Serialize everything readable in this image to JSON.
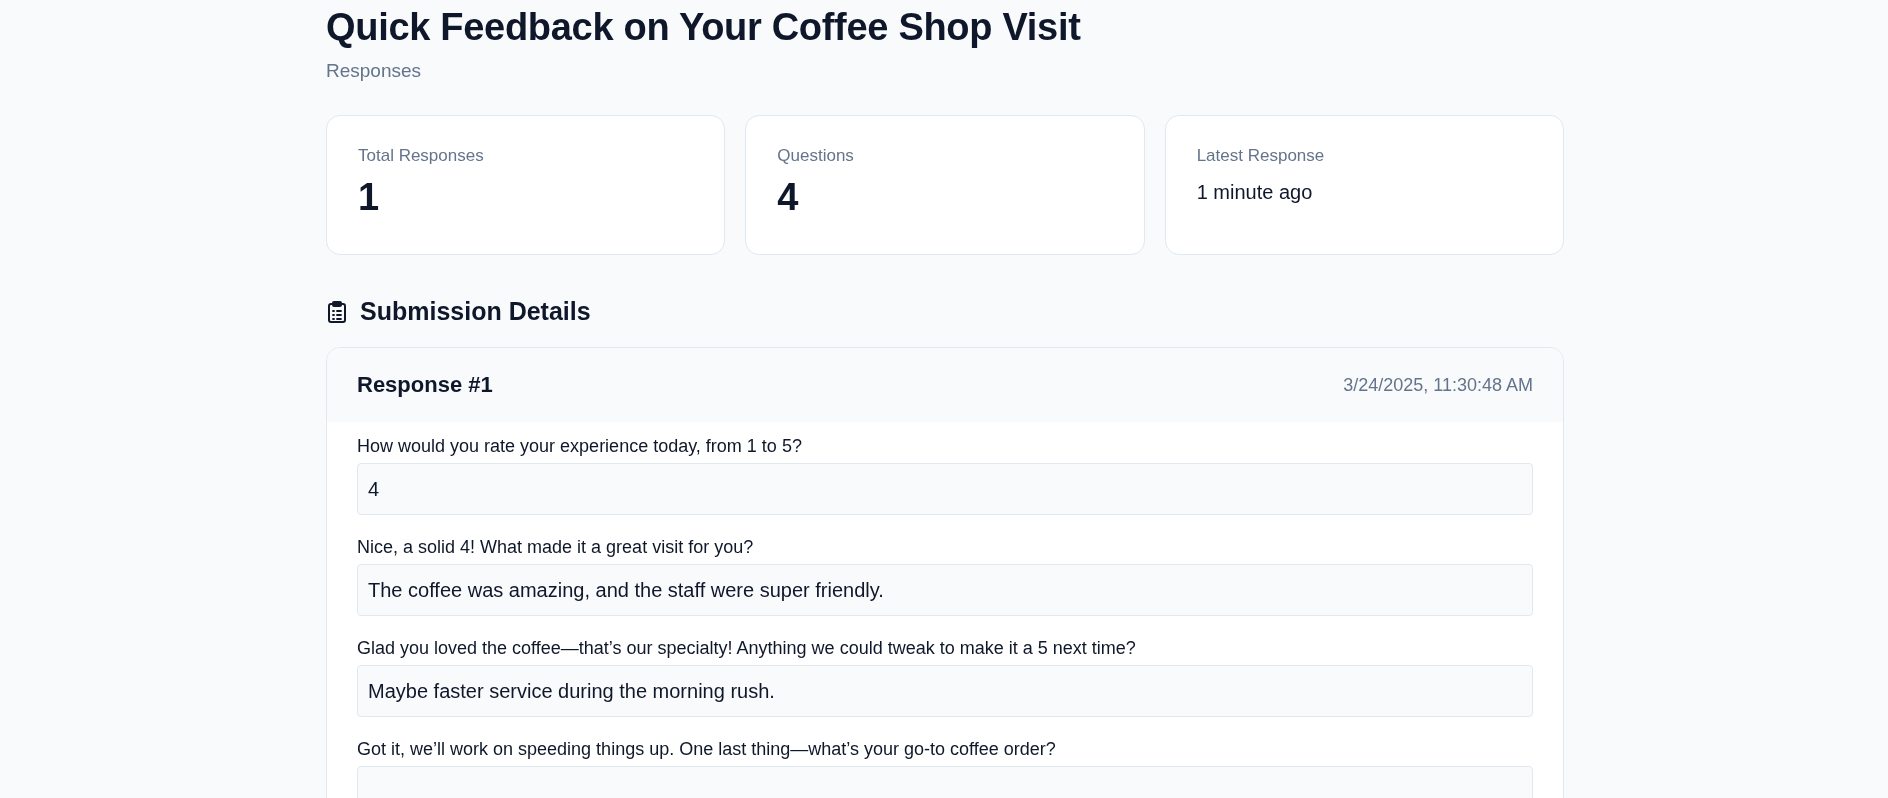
{
  "page": {
    "title": "Quick Feedback on Your Coffee Shop Visit",
    "subtitle": "Responses"
  },
  "stats": [
    {
      "label": "Total Responses",
      "value": "1",
      "kind": "number"
    },
    {
      "label": "Questions",
      "value": "4",
      "kind": "number"
    },
    {
      "label": "Latest Response",
      "value": "1 minute ago",
      "kind": "text"
    }
  ],
  "section": {
    "title": "Submission Details"
  },
  "response": {
    "title": "Response #1",
    "timestamp": "3/24/2025, 11:30:48 AM",
    "answers": [
      {
        "question": "How would you rate your experience today, from 1 to 5?",
        "answer": "4"
      },
      {
        "question": "Nice, a solid 4! What made it a great visit for you?",
        "answer": "The coffee was amazing, and the staff were super friendly."
      },
      {
        "question": "Glad you loved the coffee—that’s our specialty! Anything we could tweak to make it a 5 next time?",
        "answer": "Maybe faster service during the morning rush."
      },
      {
        "question": "Got it, we’ll work on speeding things up. One last thing—what’s your go-to coffee order?"
      }
    ]
  }
}
